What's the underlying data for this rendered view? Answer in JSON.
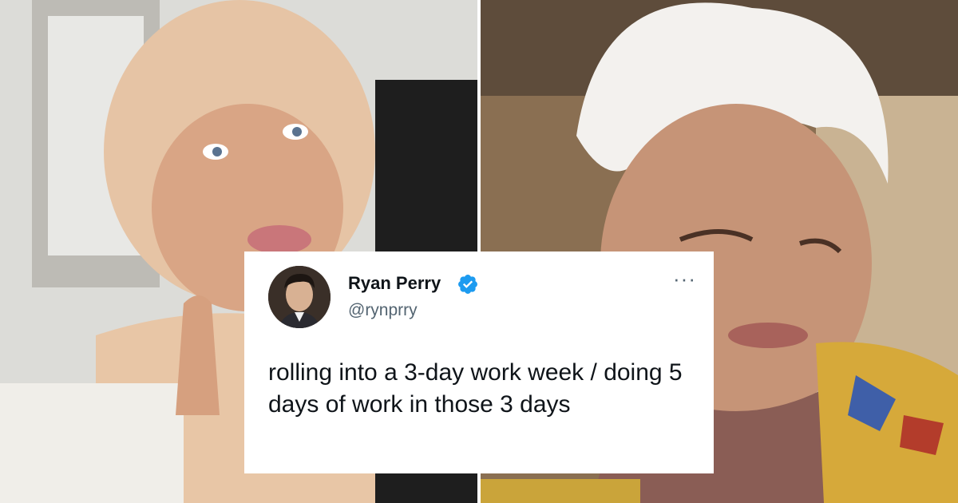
{
  "tweet": {
    "name": "Ryan Perry",
    "handle": "@rynprry",
    "text": "rolling into a 3-day work week / doing 5 days of work in those 3 days",
    "verified": true,
    "more_icon": "more-options-icon",
    "more_label": "···"
  },
  "colors": {
    "name": "#0f1419",
    "handle": "#536471",
    "verified": "#1d9bf0",
    "card_bg": "#ffffff"
  },
  "icons": {
    "verified": "verified-badge-icon"
  }
}
